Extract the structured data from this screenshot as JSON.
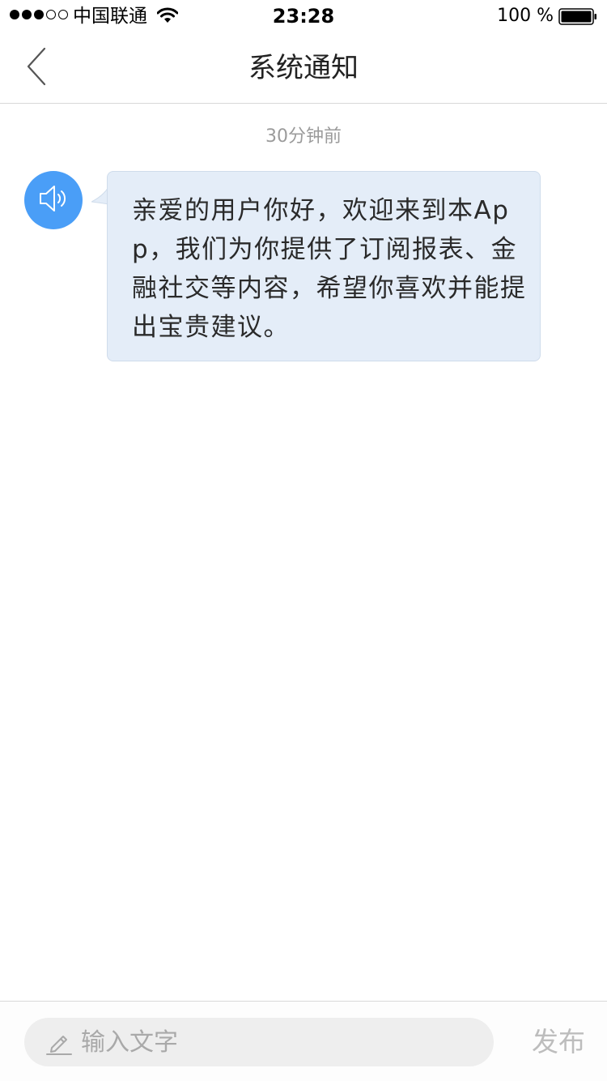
{
  "status_bar": {
    "signal_strength": "3/5",
    "carrier": "中国联通",
    "wifi_icon": "wifi-icon",
    "time": "23:28",
    "battery_percent": "100 %",
    "battery_level": 1.0
  },
  "nav": {
    "back_icon": "chevron-left-icon",
    "title": "系统通知"
  },
  "notification": {
    "timestamp": "30分钟前",
    "avatar_icon": "speaker-icon",
    "avatar_color": "#4a9ef7",
    "bubble_color": "#e4edf8",
    "message": "亲爱的用户你好，欢迎来到本App，我们为你提供了订阅报表、金融社交等内容，希望你喜欢并能提出宝贵建议。"
  },
  "composer": {
    "pencil_icon": "pencil-icon",
    "input_value": "",
    "input_placeholder": "输入文字",
    "publish_label": "发布"
  }
}
